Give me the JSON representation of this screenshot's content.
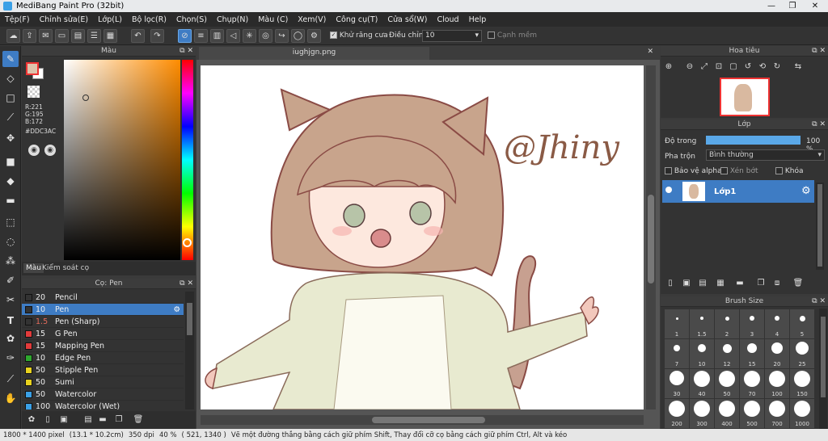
{
  "window": {
    "title": "MediBang Paint Pro (32bit)",
    "min": "—",
    "max": "❐",
    "close": "✕"
  },
  "menu": [
    "Tệp(F)",
    "Chỉnh sửa(E)",
    "Lớp(L)",
    "Bộ lọc(R)",
    "Chọn(S)",
    "Chụp(N)",
    "Màu (C)",
    "Xem(V)",
    "Công cụ(T)",
    "Cửa sổ(W)",
    "Cloud",
    "Help"
  ],
  "toolbar": {
    "antialias_label": "Khử răng cưa",
    "adjust_label": "Điều chỉnh",
    "adjust_value": "10",
    "edge_label": "Cạnh mềm"
  },
  "color_panel": {
    "title": "Màu",
    "rgb": [
      "R:221",
      "G:195",
      "B:172"
    ],
    "hex": "#DDC3AC",
    "tabs": [
      "Màu",
      "Kiểm soát cọ"
    ],
    "main_color": "#ddc3ac"
  },
  "brush_panel": {
    "title": "Cọ: Pen",
    "items": [
      {
        "size": "20",
        "name": "Pencil",
        "color": "#333333"
      },
      {
        "size": "10",
        "name": "Pen",
        "color": "#333333",
        "selected": true
      },
      {
        "size": "1.5",
        "name": "Pen (Sharp)",
        "color": "#333333"
      },
      {
        "size": "15",
        "name": "G Pen",
        "color": "#e23b3b"
      },
      {
        "size": "15",
        "name": "Mapping Pen",
        "color": "#e23b3b"
      },
      {
        "size": "10",
        "name": "Edge Pen",
        "color": "#2ea82e"
      },
      {
        "size": "50",
        "name": "Stipple Pen",
        "color": "#e8d21e"
      },
      {
        "size": "50",
        "name": "Sumi",
        "color": "#e8d21e"
      },
      {
        "size": "50",
        "name": "Watercolor",
        "color": "#3aa0e6"
      },
      {
        "size": "100",
        "name": "Watercolor (Wet)",
        "color": "#3aa0e6"
      }
    ]
  },
  "canvas": {
    "tab": "iughjgn.png",
    "signature": "@Jhiny"
  },
  "navigator": {
    "title": "Hoa tiêu"
  },
  "layer_panel": {
    "title": "Lớp",
    "opacity_label": "Độ trong",
    "opacity_value": "100 %",
    "opacity_fraction": 1.0,
    "blend_label": "Pha trộn",
    "blend_value": "Bình thường",
    "protect_alpha": "Bảo vệ alpha",
    "clip": "Xén bớt",
    "lock": "Khóa",
    "layer_name": "Lớp1"
  },
  "brush_size": {
    "title": "Brush Size",
    "sizes": [
      "1",
      "1.5",
      "2",
      "3",
      "4",
      "5",
      "7",
      "10",
      "12",
      "15",
      "20",
      "25",
      "30",
      "40",
      "50",
      "70",
      "100",
      "150",
      "200",
      "300",
      "400",
      "500",
      "700",
      "1000"
    ]
  },
  "status": {
    "pixels": "1800 * 1400 pixel",
    "cm": "(13.1 * 10.2cm)",
    "dpi": "350 dpi",
    "zoom": "40 %",
    "coords": "( 521, 1340 )",
    "hint": "Vẽ một đường thẳng bằng cách giữ phím Shift, Thay đổi cỡ cọ bằng cách giữ phím Ctrl, Alt và kéo"
  }
}
